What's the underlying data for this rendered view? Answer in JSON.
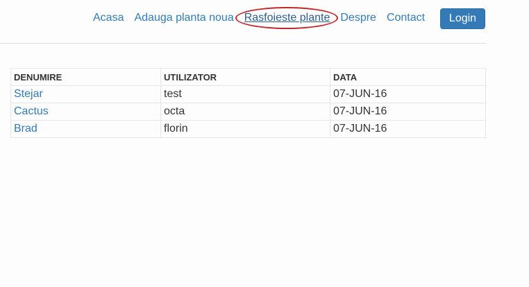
{
  "nav": {
    "items": [
      {
        "label": "Acasa"
      },
      {
        "label": "Adauga planta noua"
      },
      {
        "label": "Rasfoieste plante"
      },
      {
        "label": "Despre"
      },
      {
        "label": "Contact"
      }
    ],
    "login_label": "Login"
  },
  "table": {
    "headers": [
      "DENUMIRE",
      "UTILIZATOR",
      "DATA"
    ],
    "rows": [
      {
        "name": "Stejar",
        "user": "test",
        "date": "07-JUN-16"
      },
      {
        "name": "Cactus",
        "user": "octa",
        "date": "07-JUN-16"
      },
      {
        "name": "Brad",
        "user": "florin",
        "date": "07-JUN-16"
      }
    ]
  },
  "colors": {
    "link": "#337ab7",
    "button": "#337ab7",
    "highlight": "#c1272d"
  }
}
